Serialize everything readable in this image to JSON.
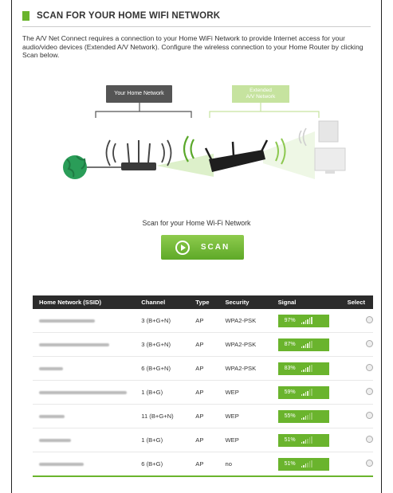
{
  "page": {
    "title": "SCAN FOR YOUR HOME WIFI NETWORK",
    "intro": "The A/V Net Connect requires a connection to your Home WiFi Network to provide Internet access for your audio/video devices (Extended A/V Network). Configure the wireless connection to your Home Router by clicking Scan below."
  },
  "diagram": {
    "home_label": "Your Home Network",
    "extended_label_line1": "Extended",
    "extended_label_line2": "A/V Network"
  },
  "scan": {
    "caption": "Scan for your Home Wi-Fi Network",
    "button_label": "SCAN"
  },
  "colors": {
    "accent": "#6ab42d",
    "header": "#2b2b2b"
  },
  "table": {
    "headers": [
      "Home Network (SSID)",
      "Channel",
      "Type",
      "Security",
      "Signal",
      "Select"
    ],
    "rows": [
      {
        "ssid_width": 70,
        "channel": "3 (B+G+N)",
        "type": "AP",
        "security": "WPA2-PSK",
        "signal": "97%",
        "level": 0.97
      },
      {
        "ssid_width": 88,
        "channel": "3 (B+G+N)",
        "type": "AP",
        "security": "WPA2-PSK",
        "signal": "87%",
        "level": 0.87
      },
      {
        "ssid_width": 30,
        "channel": "6 (B+G+N)",
        "type": "AP",
        "security": "WPA2-PSK",
        "signal": "83%",
        "level": 0.83
      },
      {
        "ssid_width": 110,
        "channel": "1 (B+G)",
        "type": "AP",
        "security": "WEP",
        "signal": "59%",
        "level": 0.59
      },
      {
        "ssid_width": 32,
        "channel": "11 (B+G+N)",
        "type": "AP",
        "security": "WEP",
        "signal": "55%",
        "level": 0.55
      },
      {
        "ssid_width": 40,
        "channel": "1 (B+G)",
        "type": "AP",
        "security": "WEP",
        "signal": "51%",
        "level": 0.51
      },
      {
        "ssid_width": 56,
        "channel": "6 (B+G)",
        "type": "AP",
        "security": "no",
        "signal": "51%",
        "level": 0.51
      }
    ]
  }
}
